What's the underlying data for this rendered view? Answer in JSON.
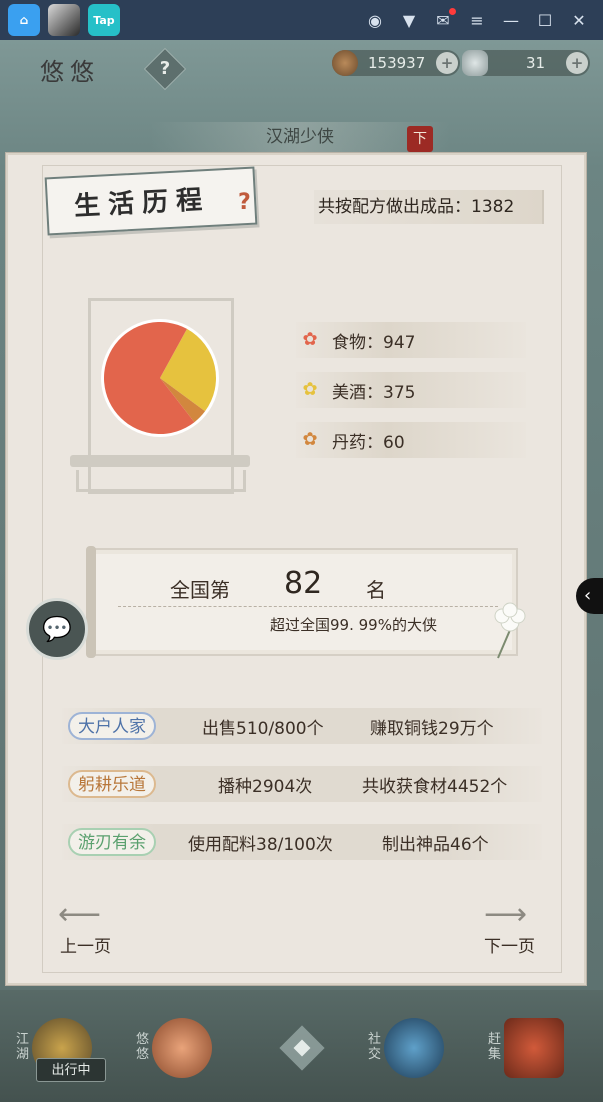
{
  "topbar": {
    "tap_label": "Tap"
  },
  "hud": {
    "title": "悠悠",
    "help": "?",
    "coins": "153937",
    "silver": "31",
    "plus": "+"
  },
  "sub_tab": {
    "label": "汉湖少侠",
    "badge": "下"
  },
  "book": {
    "section_title": "生活历程",
    "total_made": "共按配方做出成品：1382",
    "legend": [
      {
        "label": "食物：947",
        "color": "#e2654c"
      },
      {
        "label": "美酒：375",
        "color": "#e6c23e"
      },
      {
        "label": "丹药：60",
        "color": "#d2873e"
      }
    ],
    "rank": {
      "prefix": "全国第",
      "number": "82",
      "suffix": "名",
      "desc": "超过全国99. 99%的大侠"
    },
    "achievements": [
      {
        "tag": "大户人家",
        "a": "出售510/800个",
        "b": "赚取铜钱29万个",
        "color": "#4e72a8"
      },
      {
        "tag": "躬耕乐道",
        "a": "播种2904次",
        "b": "共收获食材4452个",
        "color": "#b8773a"
      },
      {
        "tag": "游刃有余",
        "a": "使用配料38/100次",
        "b": "制出神品46个",
        "color": "#5aa06e"
      }
    ],
    "prev": "上一页",
    "next": "下一页"
  },
  "chart_data": {
    "type": "pie",
    "categories": [
      "食物",
      "美酒",
      "丹药"
    ],
    "values": [
      947,
      375,
      60
    ],
    "colors": [
      "#e2654c",
      "#e6c23e",
      "#d2873e"
    ]
  },
  "bottom_nav": {
    "items": [
      {
        "label": "江湖"
      },
      {
        "label": "悠悠"
      },
      {
        "label": "社交"
      },
      {
        "label": "赶集"
      }
    ],
    "status_badge": "出行中"
  }
}
